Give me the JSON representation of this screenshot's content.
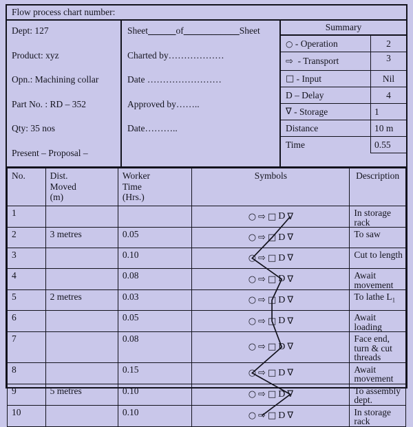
{
  "document": {
    "title_label": "Flow process chart number:"
  },
  "dept_panel": {
    "fields": [
      "Dept: 127",
      "Product: xyz",
      "Opn.: Machining collar",
      "Part No. : RD – 352",
      "Qty: 35 nos",
      "Present – Proposal –"
    ]
  },
  "sheet_panel": {
    "sheet_line_pre": "Sheet",
    "sheet_line_mid": "of",
    "sheet_line_post": "Sheet",
    "sheet_blank_1": "______",
    "sheet_blank_2": "____________",
    "charted_by": "Charted by………………",
    "date_1": "Date ……………………",
    "approved_by": "Approved by……..",
    "date_2": "Date……….."
  },
  "summary": {
    "heading": "Summary",
    "rows": [
      {
        "symbol": "○",
        "symbol_name": "circle-operation-icon",
        "label": "- Operation",
        "value": "2"
      },
      {
        "symbol": "⇨",
        "symbol_name": "arrow-transport-icon",
        "label": "- Transport",
        "value": "3"
      },
      {
        "symbol": "□",
        "symbol_name": "square-input-icon",
        "label": "- Input",
        "value": "Nil"
      },
      {
        "symbol": "D",
        "symbol_name": "d-delay-icon",
        "label": "– Delay",
        "value": "4"
      },
      {
        "symbol": "∇",
        "symbol_name": "triangle-storage-icon",
        "label": "- Storage",
        "value": "1"
      },
      {
        "symbol": "",
        "symbol_name": "distance-label",
        "label": "Distance",
        "value": "10 m"
      },
      {
        "symbol": "",
        "symbol_name": "time-label",
        "label": "Time",
        "value": "0.55"
      }
    ]
  },
  "main_table": {
    "headers": {
      "no": "No.",
      "dist": "Dist.\nMoved\n(m)",
      "dist_l1": "Dist.",
      "dist_l2": "Moved",
      "dist_l3": "(m)",
      "time_l1": "Worker",
      "time_l2": "Time",
      "time_l3": "(Hrs.)",
      "symbols": "Symbols",
      "description": "Description"
    },
    "symbol_set": [
      "○",
      "⇨",
      "□",
      "D",
      "∇"
    ],
    "rows": [
      {
        "no": "1",
        "dist": "",
        "time": "",
        "desc": "In storage rack",
        "active": 4
      },
      {
        "no": "2",
        "dist": "3 metres",
        "time": "0.05",
        "desc": " To saw",
        "active": 2
      },
      {
        "no": "3",
        "dist": "",
        "time": "0.10",
        "desc": "Cut to length",
        "active": 0
      },
      {
        "no": "4",
        "dist": "",
        "time": "0.08",
        "desc": "Await movement",
        "active": 3
      },
      {
        "no": "5",
        "dist": "2 metres",
        "time": "0.03",
        "desc": "To lathe L₁",
        "active": 2
      },
      {
        "no": "6",
        "dist": "",
        "time": "0.05",
        "desc": "Await loading",
        "active": 2
      },
      {
        "no": "7",
        "dist": "",
        "time": "0.08",
        "desc": "Face end, turn & cut threads",
        "active": 3
      },
      {
        "no": "8",
        "dist": "",
        "time": "0.15",
        "desc": "Await movement",
        "active": 0
      },
      {
        "no": "9",
        "dist": "5 metres",
        "time": "0.10",
        "desc": "To assembly dept.",
        "active": 4
      },
      {
        "no": "10",
        "dist": "",
        "time": "0.10",
        "desc": "In storage rack",
        "active": 1
      }
    ]
  },
  "chart_data": {
    "type": "table",
    "title": "Flow process chart number:",
    "symbol_legend": [
      "Operation",
      "Transport",
      "Input",
      "Delay",
      "Storage"
    ],
    "flow_path_symbol_index": [
      4,
      2,
      0,
      3,
      2,
      2,
      3,
      0,
      4,
      1
    ],
    "distances_m": [
      null,
      3,
      null,
      null,
      2,
      null,
      null,
      null,
      5,
      null
    ],
    "times_hrs": [
      null,
      0.05,
      0.1,
      0.08,
      0.03,
      0.05,
      0.08,
      0.15,
      0.1,
      0.1
    ],
    "total_distance": "10 m",
    "total_time": "0.55"
  },
  "colors": {
    "background": "#c9c7ea",
    "ink": "#12121c"
  }
}
